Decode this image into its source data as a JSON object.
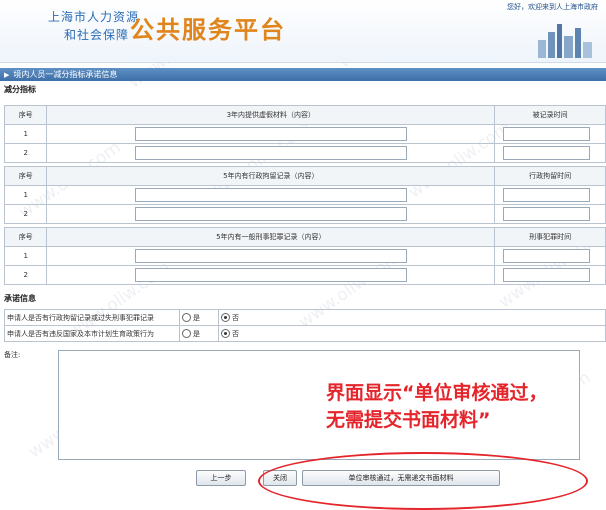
{
  "header": {
    "org_line1": "上海市人力资源",
    "org_line2": "和社会保障",
    "platform_title": "公共服务平台",
    "welcome_text": "您好，欢迎来到人上海市政府"
  },
  "title_bar": {
    "label": "境内人员一减分指标承诺信息"
  },
  "deductions": {
    "section_title": "减分指标",
    "column_index": "序号",
    "groups": [
      {
        "header": "3年内提供虚假材料（内容）",
        "right_header": "被记录时间",
        "rows": [
          "1",
          "2"
        ]
      },
      {
        "header": "5年内有行政拘留记录（内容）",
        "right_header": "行政拘留时间",
        "rows": [
          "1",
          "2"
        ]
      },
      {
        "header": "5年内有一般刑事犯罪记录（内容）",
        "right_header": "刑事犯罪时间",
        "rows": [
          "1",
          "2"
        ]
      }
    ]
  },
  "commitment": {
    "section_title": "承诺信息",
    "questions": [
      {
        "text": "申请人是否有行政拘留记录或过失刑事犯罪记录",
        "option_yes": "是",
        "option_no": "否",
        "selected": "no"
      },
      {
        "text": "申请人是否有违反国家及本市计划生育政策行为",
        "option_yes": "是",
        "option_no": "否",
        "selected": "no"
      }
    ],
    "remark_label": "备注:"
  },
  "overlay": {
    "line1": "界面显示“单位审核通过，",
    "line2": "无需提交书面材料”",
    "color": "#e4252b"
  },
  "buttons": {
    "prev": "上一步",
    "close": "关闭",
    "approve": "单位审核通过，无需递交书面材料"
  },
  "watermark": "www.oliw.com",
  "colors": {
    "accent": "#e0851b",
    "title_bar": "#4a7db5",
    "annotation": "#e4252b"
  }
}
